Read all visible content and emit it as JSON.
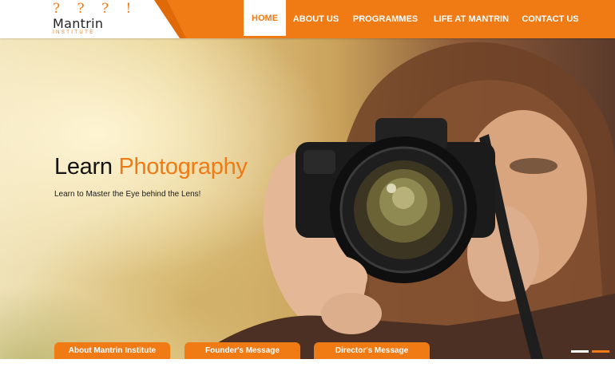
{
  "logo": {
    "marks": "? ? ? !",
    "name": "Mantrin",
    "subtitle": "INSTITUTE"
  },
  "nav": {
    "items": [
      {
        "label": "HOME",
        "active": true
      },
      {
        "label": "ABOUT US",
        "active": false
      },
      {
        "label": "PROGRAMMES",
        "active": false
      },
      {
        "label": "LIFE AT MANTRIN",
        "active": false
      },
      {
        "label": "CONTACT US",
        "active": false
      }
    ]
  },
  "hero": {
    "title_plain": "Learn",
    "title_accent": "Photography",
    "subtitle": "Learn to Master the Eye behind the Lens!",
    "image_icon": "photographer-with-camera-image"
  },
  "tabs": [
    {
      "label": "About Mantrin Institute"
    },
    {
      "label": "Founder's Message"
    },
    {
      "label": "Director's Message"
    }
  ],
  "slider": {
    "slide_count": 2,
    "active_slide": 2
  },
  "colors": {
    "accent": "#f07a14",
    "text_dark": "#141414",
    "white": "#ffffff"
  }
}
